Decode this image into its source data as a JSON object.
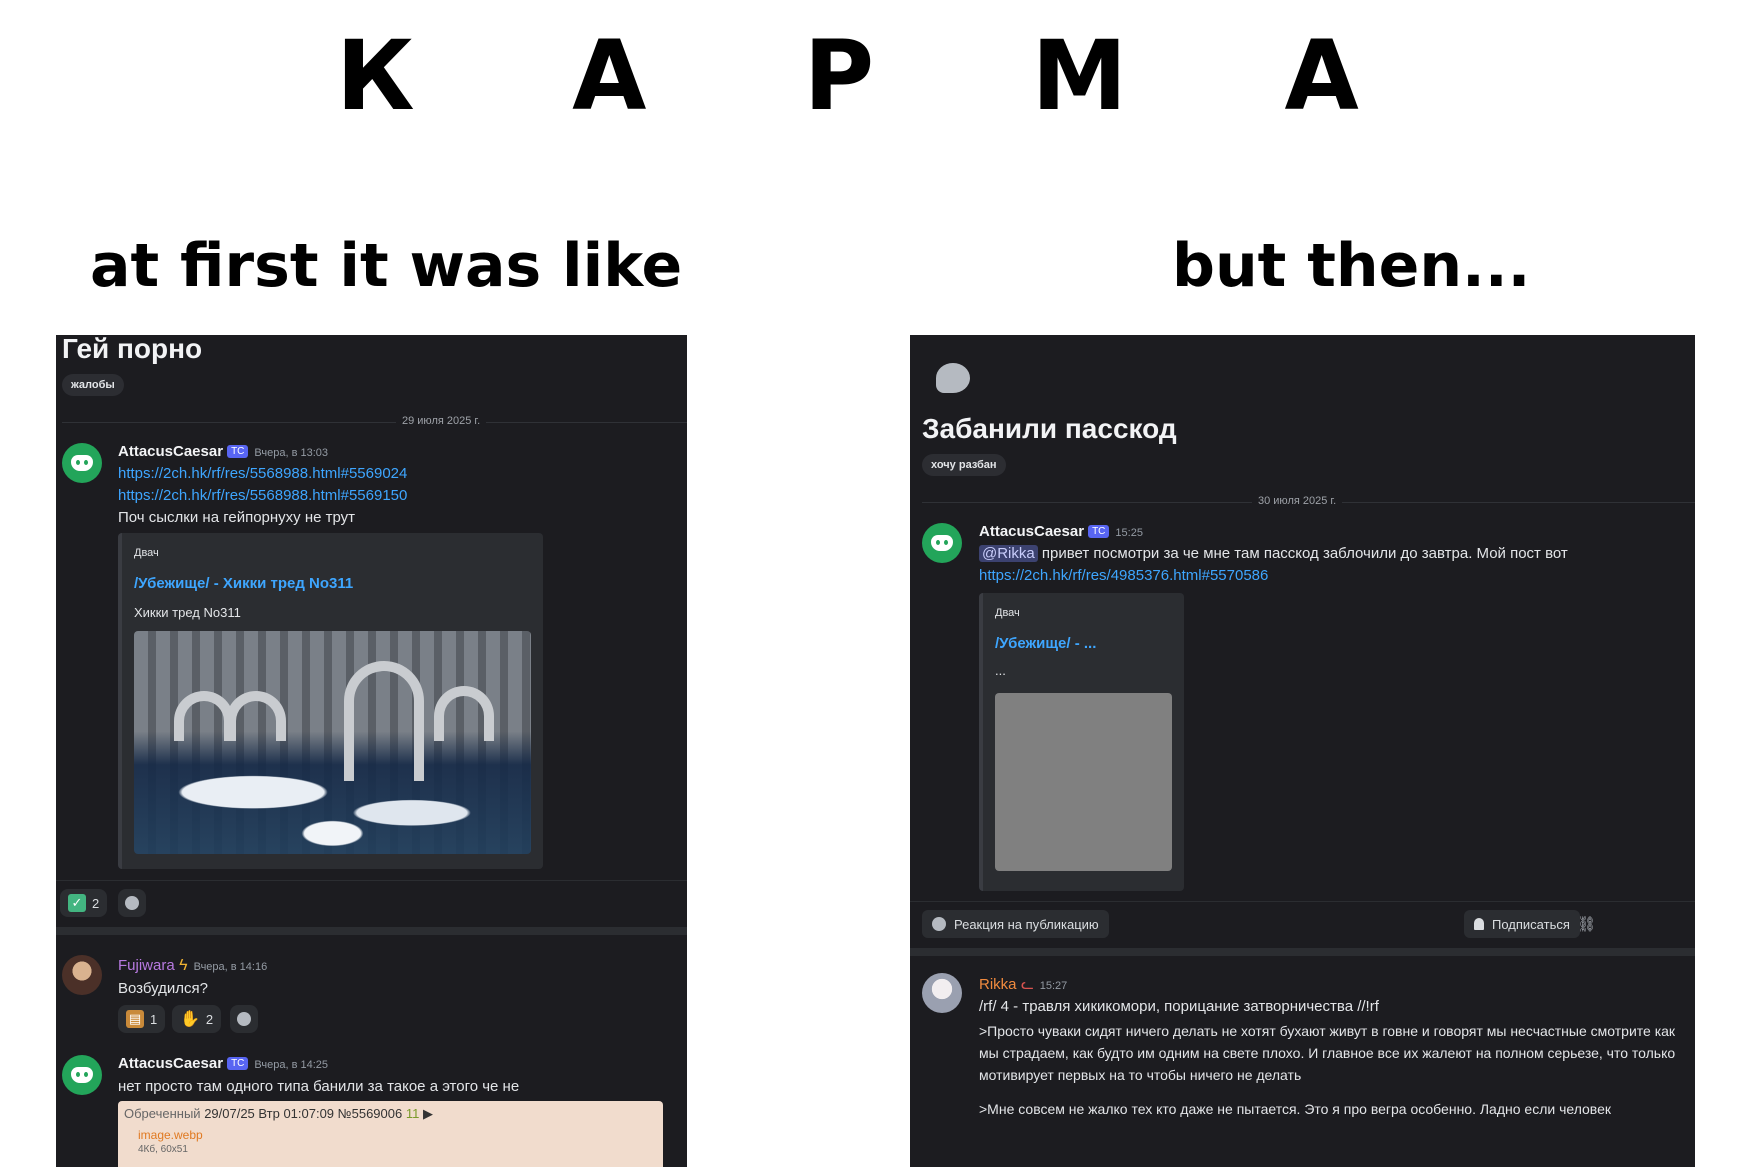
{
  "meme": {
    "title": "К А Р М А",
    "caption_left": "at first it was like",
    "caption_right": "but then..."
  },
  "left_panel": {
    "thread_title": "Гей порно",
    "tag": "жалобы",
    "date": "29 июля 2025 г.",
    "messages": [
      {
        "author": "AttacusCaesar",
        "badge": "ТС",
        "time": "Вчера, в 13:03",
        "links": [
          "https://2ch.hk/rf/res/5568988.html#5569024",
          "https://2ch.hk/rf/res/5568988.html#5569150"
        ],
        "text": "Поч сыслки на гейпорнуху не трут",
        "embed": {
          "provider": "Двач",
          "title": "/Убежище/ - Хикки тред No311",
          "description": "Хикки тред No311"
        }
      },
      {
        "author": "Fujiwara",
        "time": "Вчера, в 14:16",
        "text": "Возбудился?",
        "reactions": [
          {
            "icon": "box-emoji-icon",
            "count": "1"
          },
          {
            "icon": "thumbs-down-icon",
            "count": "2"
          }
        ]
      },
      {
        "author": "AttacusCaesar",
        "badge": "ТС",
        "time": "Вчера, в 14:25",
        "text": "нет просто там одного типа банили за такое а этого че не",
        "quote": {
          "name": "Обреченный",
          "date": "29/07/25 Втр 01:07:09",
          "post": "№5569006",
          "num": "11",
          "file": "image.webp",
          "size": "4Кб, 60x51"
        }
      }
    ],
    "post_reactions": [
      {
        "icon": "check-mark-icon",
        "count": "2"
      }
    ]
  },
  "right_panel": {
    "thread_title": "Забанили пасскод",
    "tag": "хочу разбан",
    "date": "30 июля 2025 г.",
    "message": {
      "author": "AttacusCaesar",
      "badge": "ТС",
      "time": "15:25",
      "mention": "@Rikka",
      "text": "привет посмотри за че мне там пасскод заблочили до завтра. Мой пост вот",
      "link": "https://2ch.hk/rf/res/4985376.html#5570586",
      "embed": {
        "provider": "Двач",
        "title": "/Убежище/ - ...",
        "description": "..."
      }
    },
    "bar": {
      "reaction_label": "Реакция на публикацию",
      "subscribe_label": "Подписаться"
    },
    "reply": {
      "author": "Rikka",
      "time": "15:27",
      "line1": "/rf/ 4 - травля хикикомори, порицание затворничества //!rf",
      "para1": ">Просто чуваки сидят ничего делать не хотят бухают живут в говне и говорят мы несчастные смотрите как мы страдаем, как будто им одним на свете плохо. И главное все их жалеют на полном серьезе, что только мотивирует первых на то чтобы ничего не делать",
      "para2": ">Мне совсем не жалко тех кто даже не пытается. Это я про вегра особенно. Ладно если человек"
    }
  }
}
